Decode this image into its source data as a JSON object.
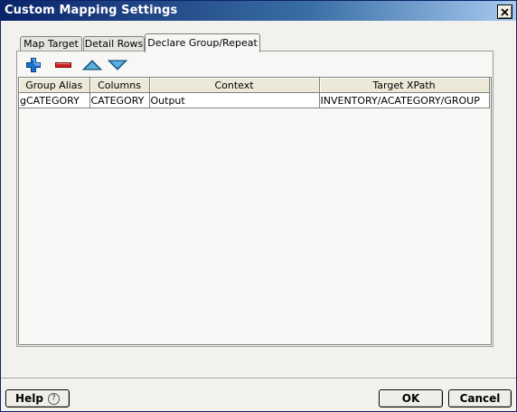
{
  "window": {
    "title": "Custom Mapping Settings",
    "close_icon": "close-icon"
  },
  "tabs": [
    {
      "label": "Map Target",
      "active": false
    },
    {
      "label": "Detail Rows",
      "active": false
    },
    {
      "label": "Declare Group/Repeat",
      "active": true
    }
  ],
  "toolbar": {
    "add_icon": "add-icon",
    "remove_icon": "remove-icon",
    "move_up_icon": "move-up-icon",
    "move_down_icon": "move-down-icon",
    "colors": {
      "add": "#1b6fd1",
      "remove": "#d02020",
      "arrows": "#2f86b8"
    }
  },
  "table": {
    "columns": [
      "Group Alias",
      "Columns",
      "Context",
      "Target XPath"
    ],
    "rows": [
      [
        "gCATEGORY",
        "CATEGORY",
        "Output",
        "INVENTORY/ACATEGORY/GROUP"
      ]
    ]
  },
  "buttons": {
    "help": "Help",
    "help_icon": "question-circle-icon",
    "ok": "OK",
    "cancel": "Cancel"
  },
  "colors": {
    "titlebar_start": "#0a246a",
    "titlebar_end": "#a6caf0",
    "dialog_bg": "#f2f1ee"
  }
}
